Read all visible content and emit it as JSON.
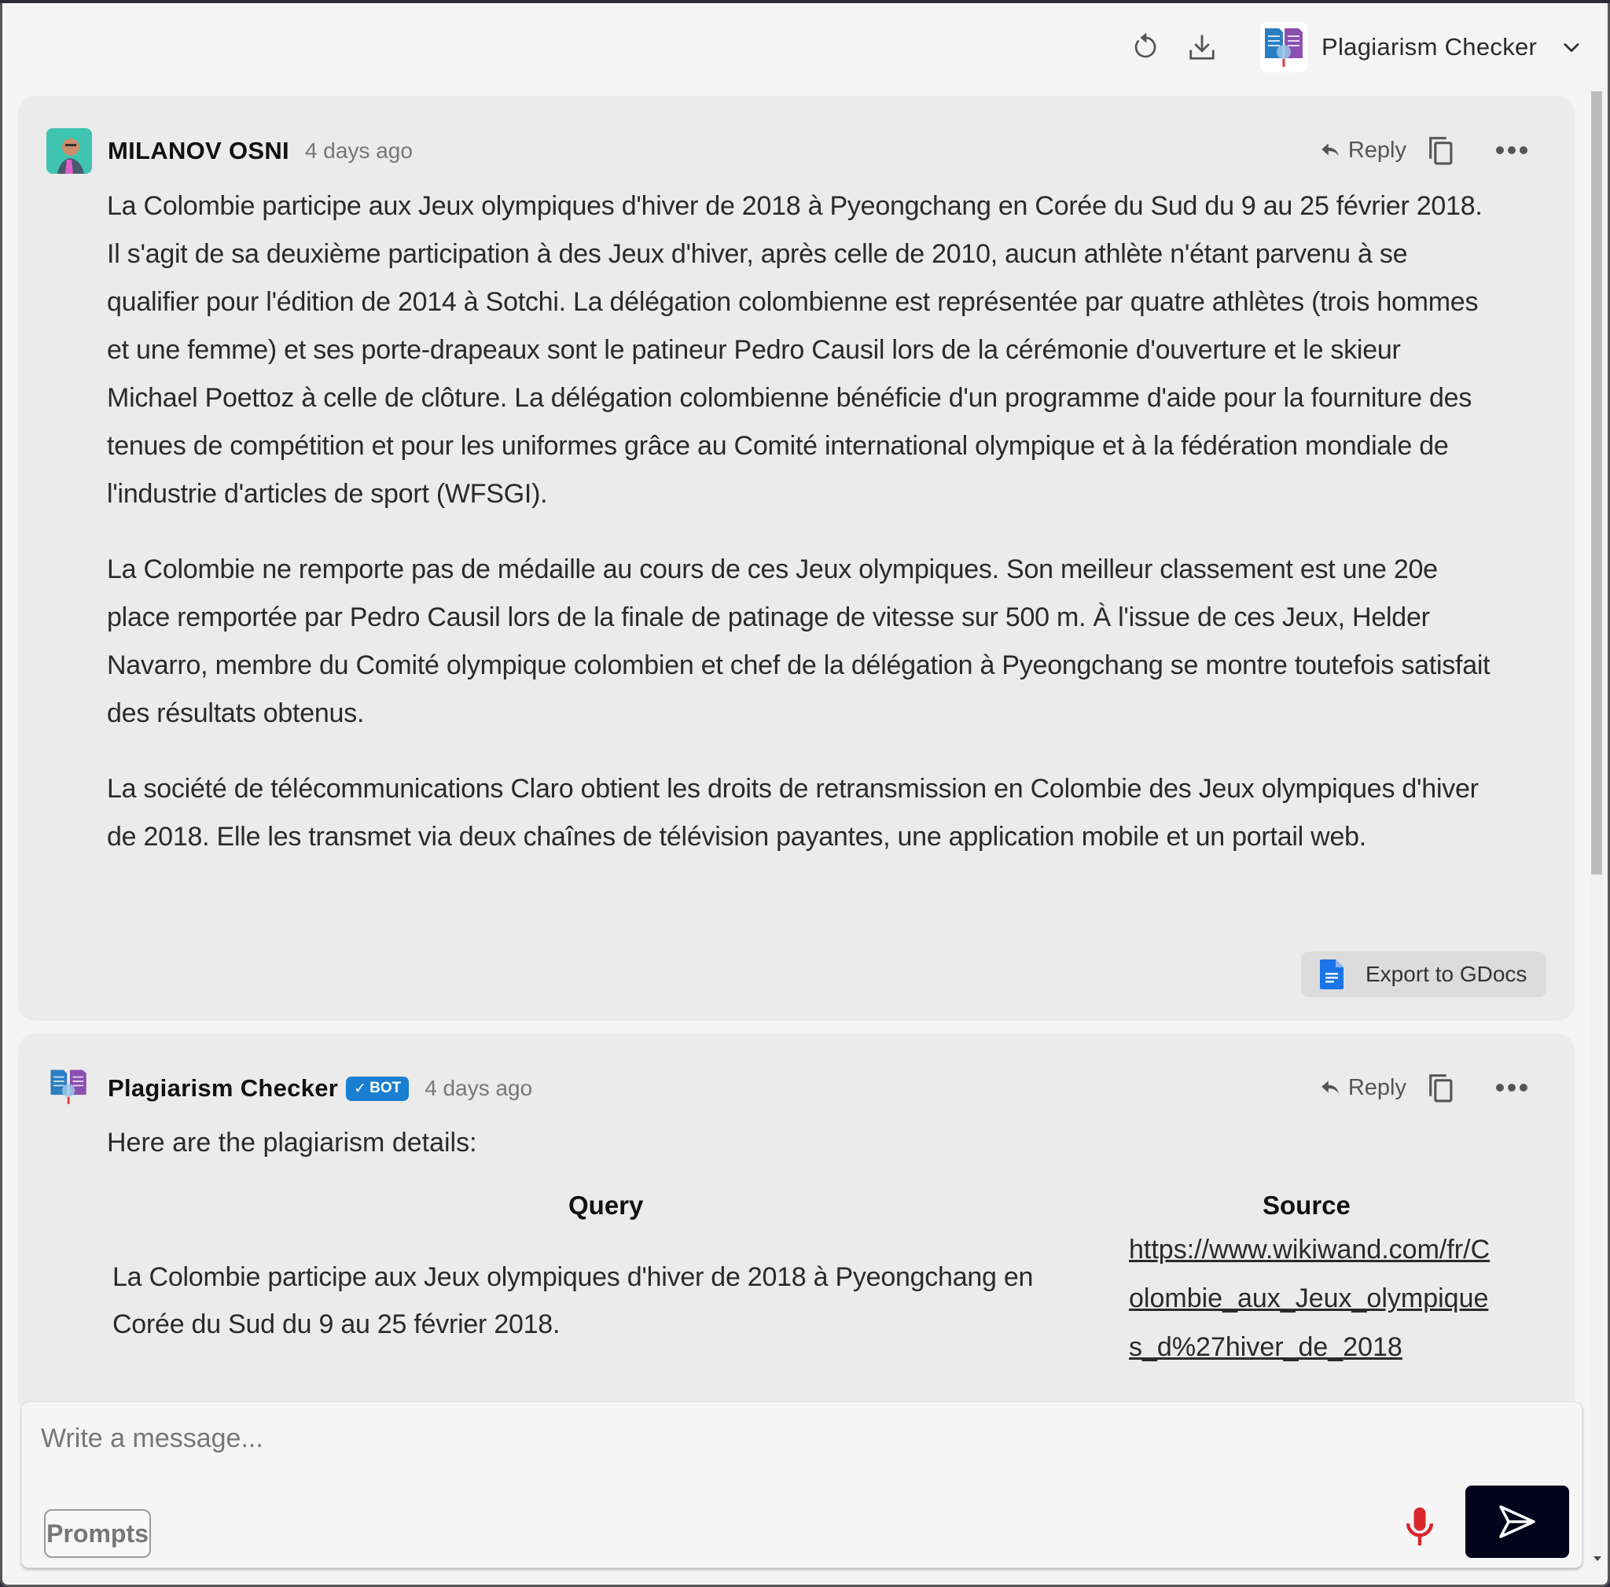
{
  "topbar": {
    "refresh_icon": "refresh-icon",
    "download_icon": "download-icon",
    "bot_name": "Plagiarism Checker",
    "chevron_icon": "chevron-down-icon"
  },
  "messages": [
    {
      "author": "MILANOV OSNI",
      "time": "4 days ago",
      "reply_label": "Reply",
      "paragraphs": [
        "La Colombie participe aux Jeux olympiques d'hiver de 2018 à Pyeongchang en Corée du Sud du 9 au 25 février 2018. Il s'agit de sa deuxième participation à des Jeux d'hiver, après celle de 2010, aucun athlète n'étant parvenu à se qualifier pour l'édition de 2014 à Sotchi. La délégation colombienne est représentée par quatre athlètes (trois hommes et une femme) et ses porte-drapeaux sont le patineur Pedro Causil lors de la cérémonie d'ouverture et le skieur Michael Poettoz à celle de clôture. La délégation colombienne bénéficie d'un programme d'aide pour la fourniture des tenues de compétition et pour les uniformes grâce au Comité international olympique et à la fédération mondiale de l'industrie d'articles de sport (WFSGI).",
        "La Colombie ne remporte pas de médaille au cours de ces Jeux olympiques. Son meilleur classement est une 20e place remportée par Pedro Causil lors de la finale de patinage de vitesse sur 500 m. À l'issue de ces Jeux, Helder Navarro, membre du Comité olympique colombien et chef de la délégation à Pyeongchang se montre toutefois satisfait des résultats obtenus.",
        "La société de télécommunications Claro obtient les droits de retransmission en Colombie des Jeux olympiques d'hiver de 2018. Elle les transmet via deux chaînes de télévision payantes, une application mobile et un portail web."
      ],
      "export_label": "Export to GDocs"
    },
    {
      "author": "Plagiarism Checker",
      "badge": "BOT",
      "time": "4 days ago",
      "reply_label": "Reply",
      "intro": "Here are the plagiarism details:",
      "table": {
        "headers": [
          "Query",
          "Source"
        ],
        "rows": [
          {
            "query": "La Colombie participe aux Jeux olympiques d'hiver de 2018 à Pyeongchang en Corée du Sud du 9 au 25 février 2018.",
            "source": "https://www.wikiwand.com/fr/Colombie_aux_Jeux_olympiques_d%27hiver_de_2018"
          }
        ]
      }
    }
  ],
  "composer": {
    "placeholder": "Write a message...",
    "prompts_label": "Prompts",
    "mic_icon": "microphone-icon",
    "send_icon": "send-icon"
  },
  "colors": {
    "bot_badge": "#1a7fd0",
    "send_button": "#02021a",
    "mic": "#d9262c",
    "gdocs": "#1a73e8"
  }
}
